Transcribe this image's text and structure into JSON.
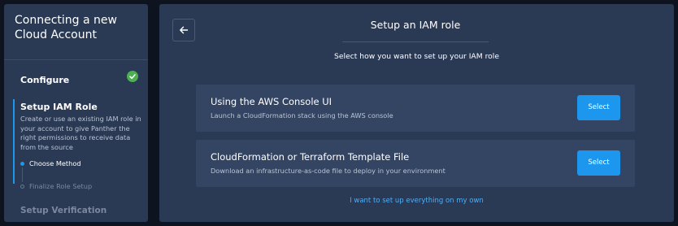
{
  "sidebar": {
    "title": "Connecting a new Cloud Account",
    "steps": [
      {
        "label": "Configure",
        "status": "complete",
        "status_icon": "check-circle-icon"
      },
      {
        "label": "Setup IAM Role",
        "status": "active",
        "description": "Create or use an existing IAM role in your account to give Panther the right permissions to receive data from the source",
        "substeps": [
          {
            "label": "Choose Method",
            "status": "active"
          },
          {
            "label": "Finalize Role Setup",
            "status": "pending"
          }
        ]
      },
      {
        "label": "Setup Verification",
        "status": "pending"
      }
    ]
  },
  "main": {
    "back_icon": "arrow-left-icon",
    "title": "Setup an IAM role",
    "subtitle": "Select how you want to set up your IAM role",
    "options": [
      {
        "title": "Using the AWS Console UI",
        "description": "Launch a CloudFormation stack using the AWS console",
        "button": "Select"
      },
      {
        "title": "CloudFormation or Terraform Template File",
        "description": "Download an infrastructure-as-code file to deploy in your environment",
        "button": "Select"
      }
    ],
    "manual_link": "I want to set up everything on my own"
  },
  "colors": {
    "page_background": "#0e1320",
    "panel_background": "#2a3954",
    "card_background": "#344564",
    "accent_blue": "#1d96ee",
    "success_green": "#4caf50",
    "link_blue": "#52aef5",
    "muted_text": "#7b889d"
  }
}
